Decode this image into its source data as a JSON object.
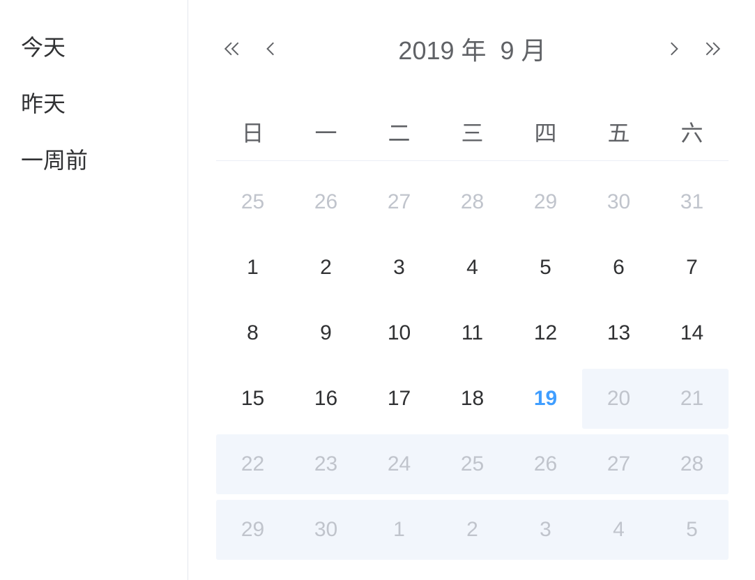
{
  "sidebar": {
    "shortcuts": [
      {
        "label": "今天"
      },
      {
        "label": "昨天"
      },
      {
        "label": "一周前"
      }
    ]
  },
  "calendar": {
    "header": {
      "year_label": "2019 年",
      "month_label": "9 月"
    },
    "weekdays": [
      "日",
      "一",
      "二",
      "三",
      "四",
      "五",
      "六"
    ],
    "weeks": [
      [
        {
          "day": 25,
          "other_month": true
        },
        {
          "day": 26,
          "other_month": true
        },
        {
          "day": 27,
          "other_month": true
        },
        {
          "day": 28,
          "other_month": true
        },
        {
          "day": 29,
          "other_month": true
        },
        {
          "day": 30,
          "other_month": true
        },
        {
          "day": 31,
          "other_month": true
        }
      ],
      [
        {
          "day": 1
        },
        {
          "day": 2
        },
        {
          "day": 3
        },
        {
          "day": 4
        },
        {
          "day": 5
        },
        {
          "day": 6
        },
        {
          "day": 7
        }
      ],
      [
        {
          "day": 8
        },
        {
          "day": 9
        },
        {
          "day": 10
        },
        {
          "day": 11
        },
        {
          "day": 12
        },
        {
          "day": 13
        },
        {
          "day": 14
        }
      ],
      [
        {
          "day": 15
        },
        {
          "day": 16
        },
        {
          "day": 17
        },
        {
          "day": 18
        },
        {
          "day": 19,
          "today": true
        },
        {
          "day": 20,
          "in_range": true
        },
        {
          "day": 21,
          "in_range": true
        }
      ],
      [
        {
          "day": 22,
          "in_range": true
        },
        {
          "day": 23,
          "in_range": true
        },
        {
          "day": 24,
          "in_range": true
        },
        {
          "day": 25,
          "in_range": true
        },
        {
          "day": 26,
          "in_range": true
        },
        {
          "day": 27,
          "in_range": true
        },
        {
          "day": 28,
          "in_range": true
        }
      ],
      [
        {
          "day": 29,
          "in_range": true
        },
        {
          "day": 30,
          "in_range": true
        },
        {
          "day": 1,
          "other_month": true,
          "in_range": true
        },
        {
          "day": 2,
          "other_month": true,
          "in_range": true
        },
        {
          "day": 3,
          "other_month": true,
          "in_range": true
        },
        {
          "day": 4,
          "other_month": true,
          "in_range": true
        },
        {
          "day": 5,
          "other_month": true,
          "in_range": true
        }
      ]
    ]
  }
}
